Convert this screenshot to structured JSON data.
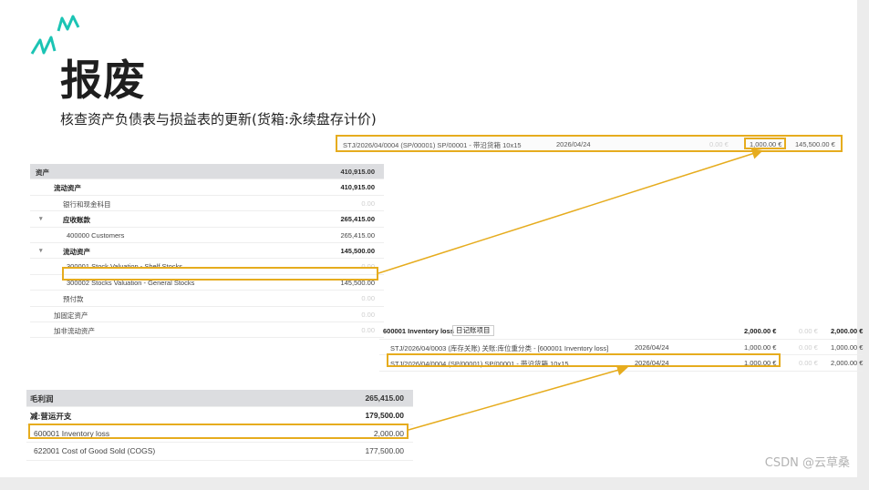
{
  "slide": {
    "title": "报废",
    "subtitle": "核查资产负债表与损益表的更新(货箱:永续盘存计价)"
  },
  "top_entry": {
    "ref": "STJ/2026/04/0004 (SP/00001) SP/00001 - 带沿货箱 10x15",
    "date": "2026/04/24",
    "debit": "0.00 €",
    "credit": "1,000.00 €",
    "balance": "145,500.00 €"
  },
  "balance_sheet": {
    "rows": [
      {
        "label": "资产",
        "amount": "410,915.00"
      },
      {
        "label": "流动资产",
        "amount": "410,915.00"
      },
      {
        "label": "银行和现金科目",
        "amount": "0.00"
      },
      {
        "label": "应收账款",
        "amount": "265,415.00"
      },
      {
        "label": "400000 Customers",
        "amount": "265,415.00"
      },
      {
        "label": "流动资产",
        "amount": "145,500.00"
      },
      {
        "label": "300001 Stock Valuation - Shelf Stocks",
        "amount": "0.00"
      },
      {
        "label": "300002 Stocks Valuation - General Stocks",
        "amount": "145,500.00"
      },
      {
        "label": "预付款",
        "amount": "0.00"
      },
      {
        "label": "加固定资产",
        "amount": "0.00"
      },
      {
        "label": "加非流动资产",
        "amount": "0.00"
      }
    ]
  },
  "general_ledger": {
    "account": "600001 Inventory loss",
    "tag": "日记账项目",
    "total_debit": "2,000.00 €",
    "total_credit": "0.00 €",
    "total_balance": "2,000.00 €",
    "lines": [
      {
        "ref": "STJ/2026/04/0003 (库存关账) 关账:库位重分类 - [600001 Inventory loss]",
        "date": "2026/04/24",
        "debit": "1,000.00 €",
        "credit": "0.00 €",
        "balance": "1,000.00 €"
      },
      {
        "ref": "STJ/2026/04/0004 (SP/00001) SP/00001 - 带沿货箱 10x15",
        "date": "2026/04/24",
        "debit": "1,000.00 €",
        "credit": "0.00 €",
        "balance": "2,000.00 €"
      }
    ]
  },
  "profit_loss": {
    "rows": [
      {
        "label": "毛利润",
        "amount": "265,415.00"
      },
      {
        "label": "减:营运开支",
        "amount": "179,500.00"
      },
      {
        "label": "600001 Inventory loss",
        "amount": "2,000.00"
      },
      {
        "label": "622001 Cost of Good Sold (COGS)",
        "amount": "177,500.00"
      }
    ]
  },
  "watermark": "CSDN @云草桑",
  "colors": {
    "highlight": "#e6ac1e",
    "accent": "#1bc4b4"
  }
}
